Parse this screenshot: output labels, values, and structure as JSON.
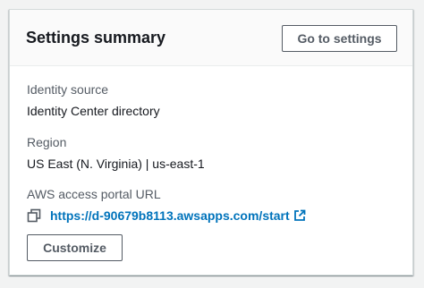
{
  "card": {
    "title": "Settings summary",
    "go_to_settings_label": "Go to settings",
    "customize_label": "Customize"
  },
  "fields": {
    "identity_source": {
      "label": "Identity source",
      "value": "Identity Center directory"
    },
    "region": {
      "label": "Region",
      "value": "US East (N. Virginia) | us-east-1"
    },
    "portal_url": {
      "label": "AWS access portal URL",
      "value": "https://d-90679b8113.awsapps.com/start"
    }
  },
  "icons": {
    "copy": "copy-icon",
    "external_link": "external-link-icon"
  },
  "colors": {
    "link": "#0073bb",
    "label": "#545b64",
    "text": "#16191f",
    "header_bg": "#fafafa"
  }
}
